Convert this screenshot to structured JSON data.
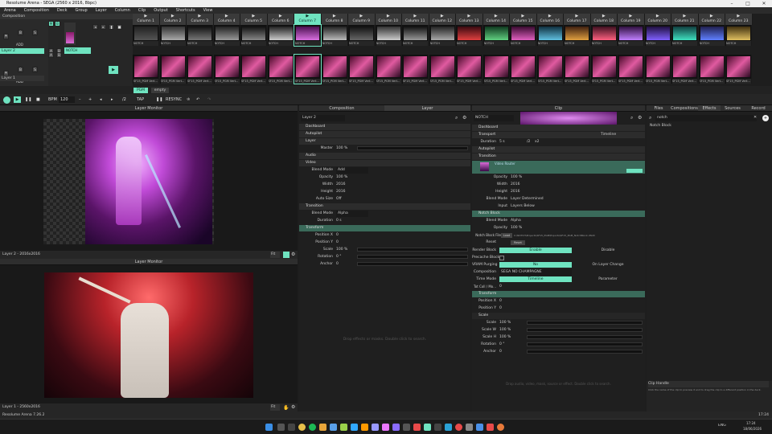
{
  "window": {
    "title": "Resolume Arena - SEGA (2560 x 2016, 8bpc)"
  },
  "menu": [
    "Arena",
    "Composition",
    "Deck",
    "Group",
    "Layer",
    "Column",
    "Clip",
    "Output",
    "Shortcuts",
    "View"
  ],
  "composition": {
    "label": "Composition"
  },
  "layers": [
    {
      "name": "Layer 2",
      "clip_label": "NOTCH",
      "active": true
    },
    {
      "name": "Layer 1",
      "clip_label": "",
      "active": false
    }
  ],
  "left_controls": {
    "b_label": "B",
    "s_label": "S",
    "m_label": "M",
    "add_label": "ADD",
    "a_label": "A"
  },
  "columns": [
    "Column 1",
    "Column 2",
    "Column 3",
    "Column 4",
    "Column 5",
    "Column 6",
    "Column 7",
    "Column 8",
    "Column 9",
    "Column 10",
    "Column 11",
    "Column 12",
    "Column 13",
    "Column 14",
    "Column 15",
    "Column 16",
    "Column 17",
    "Column 18",
    "Column 19",
    "Column 20",
    "Column 21",
    "Column 22",
    "Column 23"
  ],
  "active_column": 6,
  "row2_clip_label": "NOTCH",
  "row1_clip_label": "SF15_PGM Vert...",
  "decks": {
    "active": "PGM",
    "other": "empty"
  },
  "transport": {
    "bpm_label": "BPM",
    "bpm_value": "120",
    "div_label": "/2",
    "tap_label": "TAP",
    "resync_label": "RESYNC"
  },
  "layer_monitor_top": {
    "title": "Layer Monitor",
    "footer": "Layer 2 - 2016x2016",
    "fit": "Fit"
  },
  "layer_monitor_bottom": {
    "title": "Layer Monitor",
    "footer": "Layer 1 - 2560x2016",
    "fit": "Fit"
  },
  "middle_tabs": {
    "composition": "Composition",
    "layer": "Layer"
  },
  "layer_panel": {
    "name": "Layer 2",
    "sections": {
      "dashboard": "Dashboard",
      "autopilot": "Autopilot",
      "layer": "Layer",
      "audio": "Audio",
      "video": "Video",
      "transition": "Transition",
      "transform": "Transform"
    },
    "master_label": "Master",
    "master_value": "100 %",
    "blend_label": "Blend Mode",
    "blend_value": "Add",
    "opacity_label": "Opacity",
    "opacity_value": "100 %",
    "width_label": "Width",
    "width_value": "2016",
    "height_label": "Height",
    "height_value": "2016",
    "autosize_label": "Auto Size",
    "autosize_value": "Off",
    "t_blend_label": "Blend Mode",
    "t_blend_value": "Alpha",
    "duration_label": "Duration",
    "duration_value": "0 s",
    "posx_label": "Position X",
    "posx_value": "0",
    "posy_label": "Position Y",
    "posy_value": "0",
    "scale_label": "Scale",
    "scale_value": "100 %",
    "rotation_label": "Rotation",
    "rotation_value": "0 °",
    "anchor_label": "Anchor",
    "anchor_value": "0",
    "drop_hint": "Drop effects or masks. Double click to search."
  },
  "clip_panel": {
    "title": "Clip",
    "name": "NOTCH",
    "dashboard": "Dashboard",
    "transport": "Transport",
    "transport_mode": "Timeline",
    "duration_label": "Duration",
    "duration_value": "5 s",
    "d1": "/2",
    "d2": "x2",
    "autopilot": "Autopilot",
    "transition": "Transition",
    "video_router": "Video Router",
    "opacity_label": "Opacity",
    "opacity_value": "100 %",
    "width_label": "Width",
    "width_value": "2016",
    "height_label": "Height",
    "height_value": "2016",
    "blend_label": "Blend Mode",
    "blend_value": "Layer Determined",
    "input_label": "Input",
    "input_value": "Layers Below",
    "notch_block": "Notch Block",
    "nb_blend_label": "Blend Mode",
    "nb_blend_value": "Alpha",
    "nb_opacity_label": "Opacity",
    "nb_opacity_value": "100 %",
    "file_label": "Notch Block File",
    "file_btn": "Load",
    "file_path": "C:\\NOTCH\\Projects\\SF15_PGM\\Exports\\SF15_PGM_NotchBlock.dfxdll",
    "reset_label": "Reset",
    "reset_btn": "Reset",
    "render_label": "Render Block",
    "render_on": "Enable",
    "render_off": "Disable",
    "precache_label": "Precache Block",
    "vram_label": "VRAM Purging",
    "vram_on": "No",
    "vram_off": "On Layer Change",
    "comp_label": "Composition",
    "comp_value": "SEGA NO CHAMPAGNE",
    "timemode_label": "Time Mode",
    "timemode_on": "Timeline",
    "timemode_off": "Parameter",
    "time_label": "Tot Coll / Mo...",
    "time_value": "0",
    "transform": "Transform",
    "posx_label": "Position X",
    "posx_value": "0",
    "posy_label": "Position Y",
    "posy_value": "0",
    "scale_section": "Scale",
    "scale_label": "Scale",
    "scale_value": "100 %",
    "scalew_label": "Scale W",
    "scalew_value": "100 %",
    "scaleh_label": "Scale H",
    "scaleh_value": "100 %",
    "rotation_label": "Rotation",
    "rotation_value": "0 °",
    "anchor_label": "Anchor",
    "anchor_value": "0",
    "drop_hint": "Drop audio, video, mask, source or effect. Double click to search."
  },
  "right_tabs": {
    "files": "Files",
    "compositions": "Compositions",
    "effects": "Effects",
    "sources": "Sources",
    "record": "Record",
    "active": "effects"
  },
  "search": {
    "value": "notch",
    "result": "Notch Block"
  },
  "clip_handle": {
    "title": "Clip Handle",
    "hint": "Click the name of the clip to preview it and to drag the clip to a different position in the deck."
  },
  "statusbar": {
    "version": "Resolume Arena 7.26.2",
    "clock": "17:24"
  },
  "taskbar": {
    "lang": "ENG",
    "time": "17:24",
    "date": "18/06/2026"
  },
  "colors": {
    "accent": "#6fe3c0",
    "active_section": "#3a6a5a",
    "bg": "#1e1e1e"
  }
}
